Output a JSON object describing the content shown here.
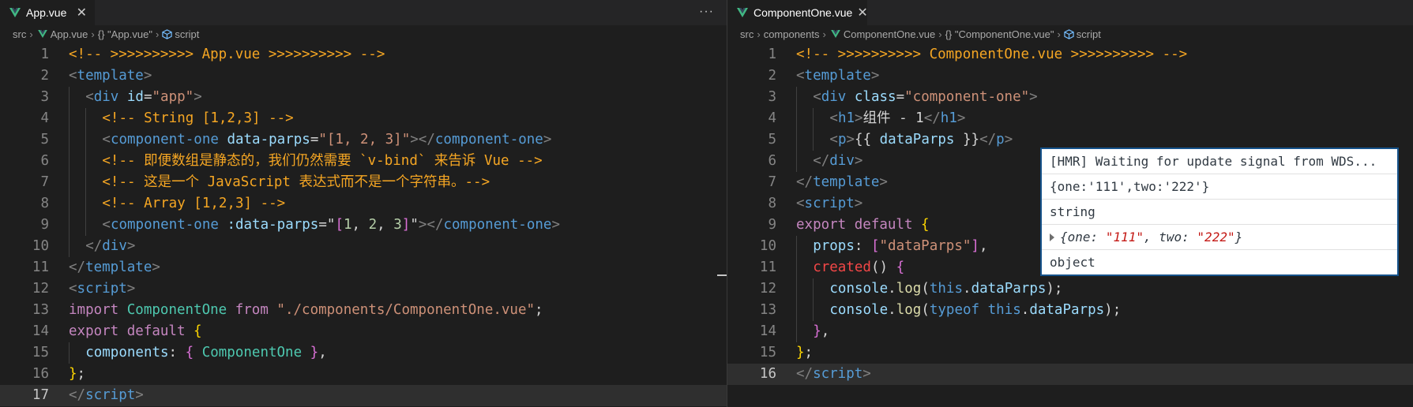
{
  "left_editor": {
    "tab_label": "App.vue",
    "more_actions": "···",
    "breadcrumb": [
      "src",
      "App.vue",
      "{} \"App.vue\"",
      "script"
    ],
    "lines": [
      {
        "num": "1",
        "indent": 0,
        "tokens": [
          [
            "<!-- >>>>>>>>>> App.vue >>>>>>>>>> -->",
            "#f5a623"
          ]
        ]
      },
      {
        "num": "2",
        "indent": 0,
        "tokens": [
          [
            "<",
            "#808080"
          ],
          [
            "template",
            "#569cd6"
          ],
          [
            ">",
            "#808080"
          ]
        ]
      },
      {
        "num": "3",
        "indent": 1,
        "tokens": [
          [
            "<",
            "#808080"
          ],
          [
            "div",
            "#569cd6"
          ],
          [
            " ",
            "#d4d4d4"
          ],
          [
            "id",
            "#9cdcfe"
          ],
          [
            "=",
            "#d4d4d4"
          ],
          [
            "\"app\"",
            "#ce9178"
          ],
          [
            ">",
            "#808080"
          ]
        ]
      },
      {
        "num": "4",
        "indent": 2,
        "tokens": [
          [
            "<!-- String [1,2,3] -->",
            "#f5a623"
          ]
        ]
      },
      {
        "num": "5",
        "indent": 2,
        "tokens": [
          [
            "<",
            "#808080"
          ],
          [
            "component-one",
            "#569cd6"
          ],
          [
            " ",
            "#d4d4d4"
          ],
          [
            "data-parps",
            "#9cdcfe"
          ],
          [
            "=",
            "#d4d4d4"
          ],
          [
            "\"[1, 2, 3]\"",
            "#ce9178"
          ],
          [
            "></",
            "#808080"
          ],
          [
            "component-one",
            "#569cd6"
          ],
          [
            ">",
            "#808080"
          ]
        ]
      },
      {
        "num": "6",
        "indent": 2,
        "tokens": [
          [
            "<!-- 即便数组是静态的，我们仍然需要 `v-bind` 来告诉 Vue -->",
            "#f5a623"
          ]
        ]
      },
      {
        "num": "7",
        "indent": 2,
        "tokens": [
          [
            "<!-- 这是一个 JavaScript 表达式而不是一个字符串。-->",
            "#f5a623"
          ]
        ]
      },
      {
        "num": "8",
        "indent": 2,
        "tokens": [
          [
            "<!-- Array [1,2,3] -->",
            "#f5a623"
          ]
        ]
      },
      {
        "num": "9",
        "indent": 2,
        "tokens": [
          [
            "<",
            "#808080"
          ],
          [
            "component-one",
            "#569cd6"
          ],
          [
            " ",
            "#d4d4d4"
          ],
          [
            ":data-parps",
            "#9cdcfe"
          ],
          [
            "=\"",
            "#d4d4d4"
          ],
          [
            "[",
            "#da70d6"
          ],
          [
            "1",
            "#b5cea8"
          ],
          [
            ", ",
            "#d4d4d4"
          ],
          [
            "2",
            "#b5cea8"
          ],
          [
            ", ",
            "#d4d4d4"
          ],
          [
            "3",
            "#b5cea8"
          ],
          [
            "]",
            "#da70d6"
          ],
          [
            "\"",
            "#d4d4d4"
          ],
          [
            "></",
            "#808080"
          ],
          [
            "component-one",
            "#569cd6"
          ],
          [
            ">",
            "#808080"
          ]
        ]
      },
      {
        "num": "10",
        "indent": 1,
        "tokens": [
          [
            "</",
            "#808080"
          ],
          [
            "div",
            "#569cd6"
          ],
          [
            ">",
            "#808080"
          ]
        ]
      },
      {
        "num": "11",
        "indent": 0,
        "tokens": [
          [
            "</",
            "#808080"
          ],
          [
            "template",
            "#569cd6"
          ],
          [
            ">",
            "#808080"
          ]
        ]
      },
      {
        "num": "12",
        "indent": 0,
        "tokens": [
          [
            "<",
            "#808080"
          ],
          [
            "script",
            "#569cd6"
          ],
          [
            ">",
            "#808080"
          ]
        ]
      },
      {
        "num": "13",
        "indent": 0,
        "tokens": [
          [
            "import ",
            "#c586c0"
          ],
          [
            "ComponentOne",
            "#4ec9b0"
          ],
          [
            " from ",
            "#c586c0"
          ],
          [
            "\"./components/ComponentOne.vue\"",
            "#ce9178"
          ],
          [
            ";",
            "#d4d4d4"
          ]
        ]
      },
      {
        "num": "14",
        "indent": 0,
        "tokens": [
          [
            "export default ",
            "#c586c0"
          ],
          [
            "{",
            "#ffd700"
          ]
        ]
      },
      {
        "num": "15",
        "indent": 1,
        "tokens": [
          [
            "components",
            "#9cdcfe"
          ],
          [
            ": ",
            "#d4d4d4"
          ],
          [
            "{ ",
            "#da70d6"
          ],
          [
            "ComponentOne",
            "#4ec9b0"
          ],
          [
            " }",
            "#da70d6"
          ],
          [
            ",",
            "#d4d4d4"
          ]
        ]
      },
      {
        "num": "16",
        "indent": 0,
        "tokens": [
          [
            "}",
            "#ffd700"
          ],
          [
            ";",
            "#d4d4d4"
          ]
        ]
      },
      {
        "num": "17",
        "indent": 0,
        "current": true,
        "tokens": [
          [
            "</",
            "#808080"
          ],
          [
            "script",
            "#569cd6"
          ],
          [
            ">",
            "#808080"
          ]
        ]
      }
    ]
  },
  "right_editor": {
    "tab_label": "ComponentOne.vue",
    "breadcrumb": [
      "src",
      "components",
      "ComponentOne.vue",
      "{} \"ComponentOne.vue\"",
      "script"
    ],
    "lines": [
      {
        "num": "1",
        "indent": 0,
        "tokens": [
          [
            "<!-- >>>>>>>>>> ComponentOne.vue >>>>>>>>>> -->",
            "#f5a623"
          ]
        ]
      },
      {
        "num": "2",
        "indent": 0,
        "tokens": [
          [
            "<",
            "#808080"
          ],
          [
            "template",
            "#569cd6"
          ],
          [
            ">",
            "#808080"
          ]
        ]
      },
      {
        "num": "3",
        "indent": 1,
        "tokens": [
          [
            "<",
            "#808080"
          ],
          [
            "div",
            "#569cd6"
          ],
          [
            " ",
            "#d4d4d4"
          ],
          [
            "class",
            "#9cdcfe"
          ],
          [
            "=",
            "#d4d4d4"
          ],
          [
            "\"component-one\"",
            "#ce9178"
          ],
          [
            ">",
            "#808080"
          ]
        ]
      },
      {
        "num": "4",
        "indent": 2,
        "tokens": [
          [
            "<",
            "#808080"
          ],
          [
            "h1",
            "#569cd6"
          ],
          [
            ">",
            "#808080"
          ],
          [
            "组件 - 1",
            "#d4d4d4"
          ],
          [
            "</",
            "#808080"
          ],
          [
            "h1",
            "#569cd6"
          ],
          [
            ">",
            "#808080"
          ]
        ]
      },
      {
        "num": "5",
        "indent": 2,
        "tokens": [
          [
            "<",
            "#808080"
          ],
          [
            "p",
            "#569cd6"
          ],
          [
            ">",
            "#808080"
          ],
          [
            "{{ ",
            "#d4d4d4"
          ],
          [
            "dataParps",
            "#9cdcfe"
          ],
          [
            " }}",
            "#d4d4d4"
          ],
          [
            "</",
            "#808080"
          ],
          [
            "p",
            "#569cd6"
          ],
          [
            ">",
            "#808080"
          ]
        ]
      },
      {
        "num": "6",
        "indent": 1,
        "tokens": [
          [
            "</",
            "#808080"
          ],
          [
            "div",
            "#569cd6"
          ],
          [
            ">",
            "#808080"
          ]
        ]
      },
      {
        "num": "7",
        "indent": 0,
        "tokens": [
          [
            "</",
            "#808080"
          ],
          [
            "template",
            "#569cd6"
          ],
          [
            ">",
            "#808080"
          ]
        ]
      },
      {
        "num": "8",
        "indent": 0,
        "tokens": [
          [
            "<",
            "#808080"
          ],
          [
            "script",
            "#569cd6"
          ],
          [
            ">",
            "#808080"
          ]
        ]
      },
      {
        "num": "9",
        "indent": 0,
        "tokens": [
          [
            "export default ",
            "#c586c0"
          ],
          [
            "{",
            "#ffd700"
          ]
        ]
      },
      {
        "num": "10",
        "indent": 1,
        "tokens": [
          [
            "props",
            "#9cdcfe"
          ],
          [
            ": ",
            "#d4d4d4"
          ],
          [
            "[",
            "#da70d6"
          ],
          [
            "\"dataParps\"",
            "#ce9178"
          ],
          [
            "]",
            "#da70d6"
          ],
          [
            ",",
            "#d4d4d4"
          ]
        ]
      },
      {
        "num": "11",
        "indent": 1,
        "tokens": [
          [
            "created",
            "#f44747"
          ],
          [
            "() ",
            "#d4d4d4"
          ],
          [
            "{",
            "#da70d6"
          ]
        ]
      },
      {
        "num": "12",
        "indent": 2,
        "tokens": [
          [
            "console",
            "#9cdcfe"
          ],
          [
            ".",
            "#d4d4d4"
          ],
          [
            "log",
            "#dcdcaa"
          ],
          [
            "(",
            "#d4d4d4"
          ],
          [
            "this",
            "#569cd6"
          ],
          [
            ".",
            "#d4d4d4"
          ],
          [
            "dataParps",
            "#9cdcfe"
          ],
          [
            ");",
            "#d4d4d4"
          ]
        ]
      },
      {
        "num": "13",
        "indent": 2,
        "tokens": [
          [
            "console",
            "#9cdcfe"
          ],
          [
            ".",
            "#d4d4d4"
          ],
          [
            "log",
            "#dcdcaa"
          ],
          [
            "(",
            "#d4d4d4"
          ],
          [
            "typeof ",
            "#569cd6"
          ],
          [
            "this",
            "#569cd6"
          ],
          [
            ".",
            "#d4d4d4"
          ],
          [
            "dataParps",
            "#9cdcfe"
          ],
          [
            ");",
            "#d4d4d4"
          ]
        ]
      },
      {
        "num": "14",
        "indent": 1,
        "tokens": [
          [
            "}",
            "#da70d6"
          ],
          [
            ",",
            "#d4d4d4"
          ]
        ]
      },
      {
        "num": "15",
        "indent": 0,
        "tokens": [
          [
            "}",
            "#ffd700"
          ],
          [
            ";",
            "#d4d4d4"
          ]
        ]
      },
      {
        "num": "16",
        "indent": 0,
        "current": true,
        "tokens": [
          [
            "</",
            "#808080"
          ],
          [
            "script",
            "#569cd6"
          ],
          [
            ">",
            "#808080"
          ]
        ]
      }
    ]
  },
  "console": {
    "hmr": "[HMR] Waiting for update signal from WDS...",
    "obj_text": "{one:'111',two:'222'}",
    "string_text": "string",
    "expanded_object": {
      "open": "{",
      "key1": "one: ",
      "val1": "\"111\"",
      "sep": ", ",
      "key2": "two: ",
      "val2": "\"222\"",
      "close": "}"
    },
    "object_text": "object"
  },
  "colors": {
    "comment": "#f5a623",
    "tag": "#569cd6",
    "attr": "#9cdcfe",
    "string": "#ce9178",
    "keyword": "#c586c0",
    "class": "#4ec9b0",
    "console_border": "#15528a",
    "console_string": "#c41a16"
  },
  "icons": {
    "vue": "vue-logo-icon",
    "chevron": "chevron-right-icon",
    "braces": "braces-icon",
    "symbol": "cube-icon",
    "more": "more-actions-icon",
    "close": "close-icon",
    "expand": "expand-triangle-icon"
  }
}
